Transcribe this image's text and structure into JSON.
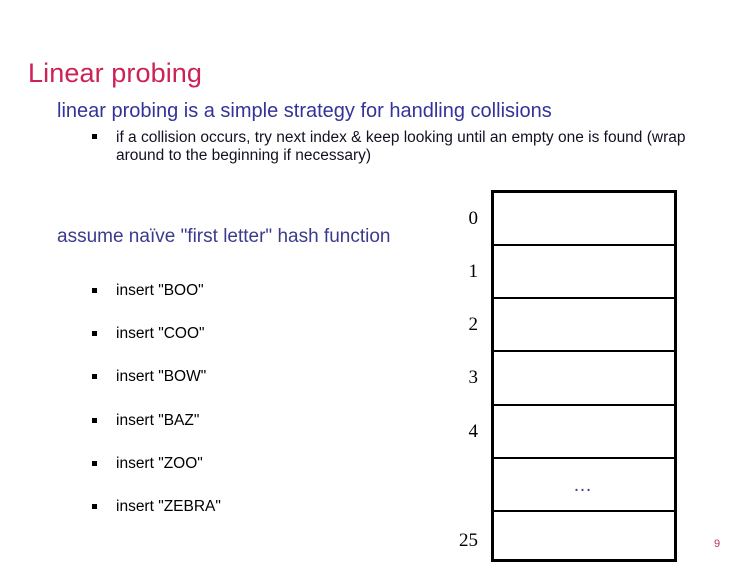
{
  "slide": {
    "title": "Linear probing",
    "page_number": "9",
    "accent_color": "#cc2255",
    "heading_color": "#333399",
    "body_color": "#111122",
    "assume_color": "#3b3b8c"
  },
  "content": {
    "lead_line": "linear probing is a simple strategy for handling collisions",
    "collision_bullet": "if a collision occurs, try next index & keep looking until an empty one is found (wrap around to the beginning if necessary)",
    "assume_line": "assume naïve \"first letter\" hash function",
    "bullet_glyph": "§"
  },
  "insert_list": [
    {
      "label": "insert \"BOO\""
    },
    {
      "label": "insert \"COO\""
    },
    {
      "label": "insert \"BOW\""
    },
    {
      "label": "insert \"BAZ\""
    },
    {
      "label": "insert \"ZOO\""
    },
    {
      "label": "insert \"ZEBRA\""
    }
  ],
  "hash_table": {
    "rows": [
      {
        "index": "0",
        "value": ""
      },
      {
        "index": "1",
        "value": ""
      },
      {
        "index": "2",
        "value": ""
      },
      {
        "index": "3",
        "value": ""
      },
      {
        "index": "4",
        "value": ""
      },
      {
        "index": "",
        "value": "…"
      },
      {
        "index": "25",
        "value": ""
      }
    ]
  }
}
